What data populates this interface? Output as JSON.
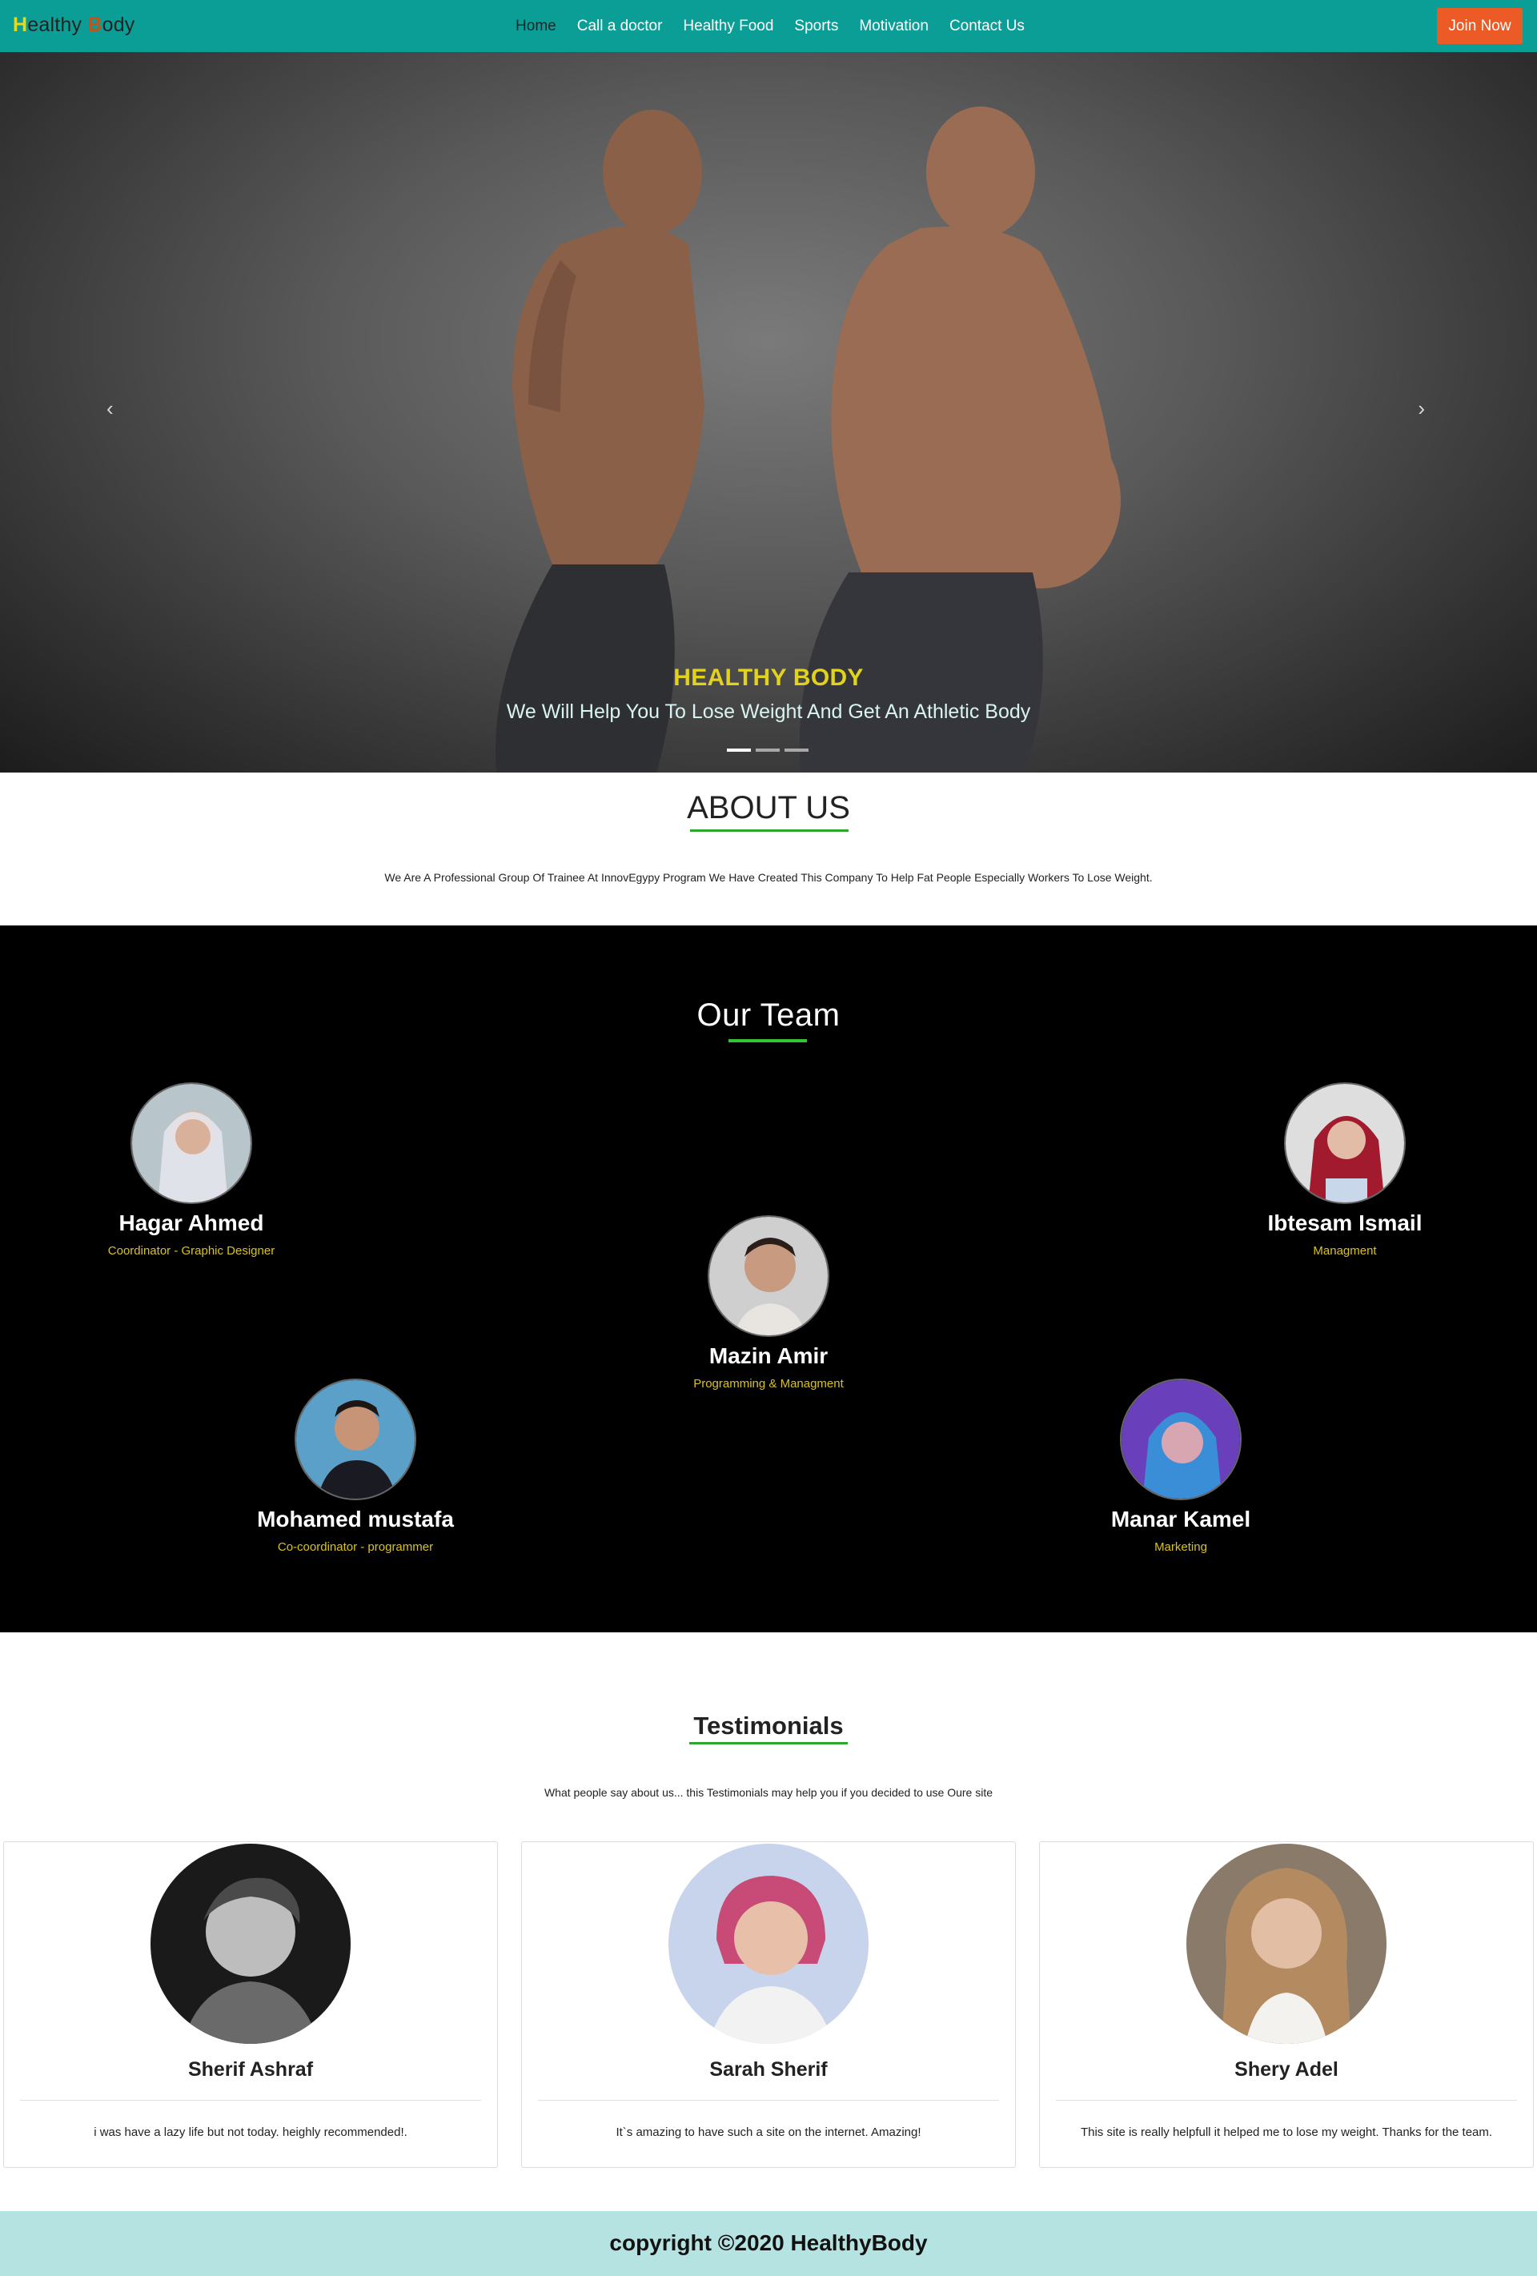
{
  "navbar": {
    "brand_h": "H",
    "brand_mid": "ealthy ",
    "brand_b": "B",
    "brand_end": "ody",
    "links": [
      "Home",
      "Call a doctor",
      "Healthy Food",
      "Sports",
      "Motivation",
      "Contact Us"
    ],
    "active": "Home",
    "join_label": "Join Now"
  },
  "hero": {
    "title": "HEALTHY BODY",
    "subtitle": "We Will Help You To Lose Weight And Get An Athletic Body",
    "prev_icon": "chevron-left-icon",
    "next_icon": "chevron-right-icon",
    "prev_glyph": "‹",
    "next_glyph": "›",
    "slides": 3,
    "active_slide": 1
  },
  "about": {
    "title": "ABOUT US",
    "text": "We Are A Professional Group Of Trainee At InnovEgypy Program We Have Created This Company To Help Fat People Especially Workers To Lose Weight."
  },
  "team": {
    "title": "Our Team",
    "members": [
      {
        "name": "Hagar Ahmed",
        "role": "Coordinator - Graphic Designer"
      },
      {
        "name": "Ibtesam Ismail",
        "role": "Managment"
      },
      {
        "name": "Mazin Amir",
        "role": "Programming & Managment"
      },
      {
        "name": "Mohamed mustafa",
        "role": "Co-coordinator - programmer"
      },
      {
        "name": "Manar Kamel",
        "role": "Marketing"
      }
    ]
  },
  "testimonials": {
    "title": "Testimonials",
    "subtitle": "What people say about us... this Testimonials may help you if you decided to use Oure site",
    "cards": [
      {
        "name": "Sherif Ashraf",
        "quote": "i was have a lazy life but not today. heighly recommended!."
      },
      {
        "name": "Sarah Sherif",
        "quote": "It`s amazing to have such a site on the internet. Amazing!"
      },
      {
        "name": "Shery Adel",
        "quote": "This site is really helpfull it helped me to lose my weight. Thanks for the team."
      }
    ]
  },
  "footer": {
    "text": "copyright ©2020 HealthyBody"
  },
  "colors": {
    "navbar": "#0a9e96",
    "join": "#ec5a25",
    "accent_yellow": "#e2d21e",
    "accent_green": "#2ea52e",
    "footer": "#b5e3e1"
  }
}
